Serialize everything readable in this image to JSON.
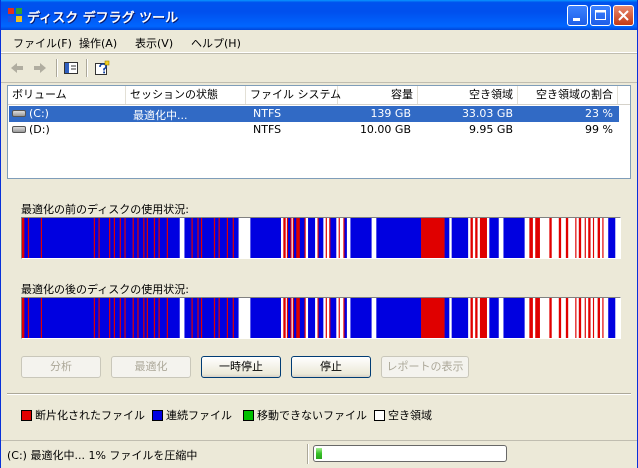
{
  "window": {
    "title": "ディスク デフラグ ツール",
    "controls": [
      "minimize",
      "maximize",
      "close"
    ]
  },
  "menu": {
    "items": [
      {
        "label": "ファイル(F)"
      },
      {
        "label": "操作(A)"
      },
      {
        "label": "表示(V)"
      },
      {
        "label": "ヘルプ(H)"
      }
    ]
  },
  "toolbar": {
    "icons": [
      "back-arrow-icon",
      "forward-arrow-icon",
      "show-hide-pane-icon",
      "help-icon"
    ]
  },
  "volumes": {
    "headers": [
      "ボリューム",
      "セッションの状態",
      "ファイル システム",
      "容量",
      "空き領域",
      "空き領域の割合"
    ],
    "rows": [
      {
        "volume": "(C:)",
        "status": "最適化中...",
        "fs": "NTFS",
        "capacity": "139 GB",
        "free": "33.03 GB",
        "percent": "23 %",
        "selected": true
      },
      {
        "volume": "(D:)",
        "status": "",
        "fs": "NTFS",
        "capacity": "10.00 GB",
        "free": "9.95 GB",
        "percent": "99 %",
        "selected": false
      }
    ]
  },
  "analysis": {
    "before_label": "最適化の前のディスクの使用状況:",
    "after_label": "最適化の後のディスクの使用状況:"
  },
  "buttons": {
    "analyze": "分析",
    "defragment": "最適化",
    "pause": "一時停止",
    "stop": "停止",
    "view_report": "レポートの表示"
  },
  "legend": {
    "items": [
      {
        "label": "断片化されたファイル",
        "color": "#e00000"
      },
      {
        "label": "連続ファイル",
        "color": "#0000e0"
      },
      {
        "label": "移動できないファイル",
        "color": "#00c000"
      },
      {
        "label": "空き領域",
        "color": "#ffffff"
      }
    ]
  },
  "status": {
    "text": "(C:) 最適化中... 1%  ファイルを圧縮中",
    "progress_percent": 1
  },
  "colors": {
    "fragmented": "#e00000",
    "contiguous": "#0000e0",
    "free": "#ffffff",
    "selection": "#316ac5"
  }
}
